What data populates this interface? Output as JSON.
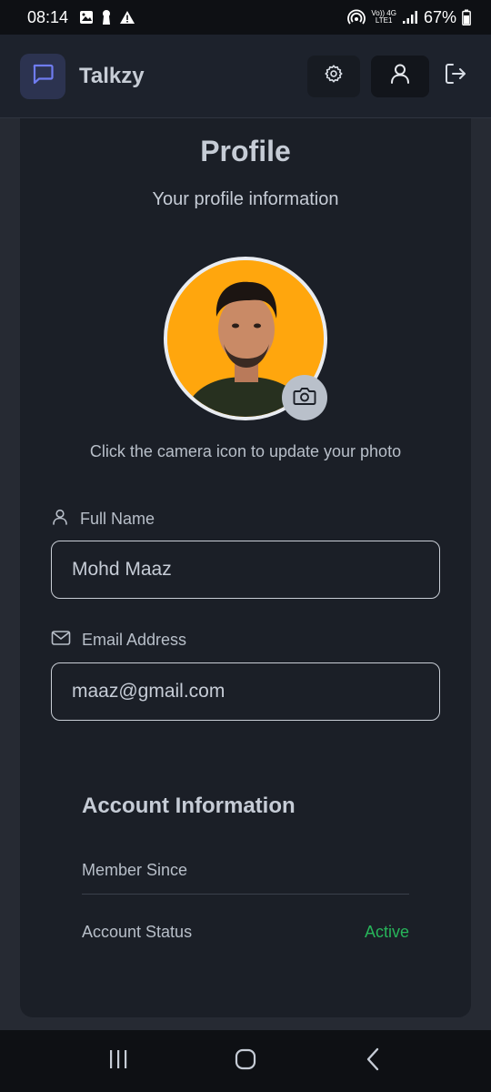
{
  "status_bar": {
    "time": "08:14",
    "network_top": "Vo)) 4G",
    "network_bottom": "LTE1",
    "battery": "67%"
  },
  "header": {
    "app_name": "Talkzy",
    "accent_color": "#6f7cf0",
    "icons": [
      "chat-icon",
      "settings-icon",
      "user-icon",
      "logout-icon"
    ]
  },
  "profile": {
    "title": "Profile",
    "subtitle": "Your profile information",
    "photo_hint": "Click the camera icon to update your photo",
    "avatar_bg": "#ffa60d"
  },
  "fields": {
    "name_label": "Full Name",
    "name_value": "Mohd Maaz",
    "email_label": "Email Address",
    "email_value": "maaz@gmail.com"
  },
  "account": {
    "heading": "Account Information",
    "member_since_label": "Member Since",
    "status_label": "Account Status",
    "status_value": "Active",
    "status_color": "#27b55a"
  },
  "nav": {
    "buttons": [
      "recent-apps",
      "home",
      "back"
    ]
  }
}
